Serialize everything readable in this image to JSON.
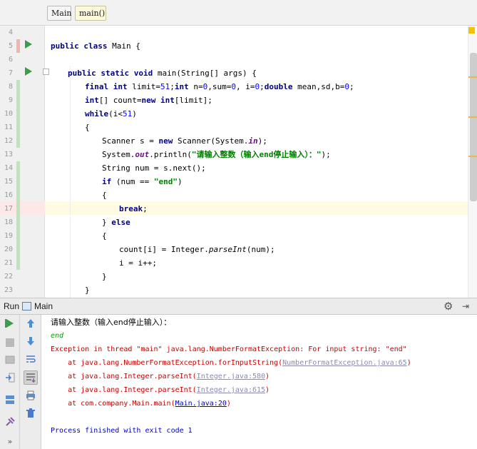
{
  "breadcrumb": [
    "Main",
    "main()"
  ],
  "editor": {
    "line_numbers": [
      "4",
      "5",
      "6",
      "7",
      "8",
      "9",
      "10",
      "11",
      "12",
      "13",
      "14",
      "15",
      "16",
      "17",
      "18",
      "19",
      "20",
      "21",
      "22",
      "23"
    ],
    "code": {
      "l5": {
        "a": "public class ",
        "b": "Main {"
      },
      "l7": {
        "a": "public static void ",
        "b": "main(String[] args) {"
      },
      "l8": {
        "a": "final int ",
        "b": "limit=",
        "c": "51",
        "d": ";",
        "e": "int ",
        "f": "n=",
        "g": "0",
        "h": ",sum=",
        "i": "0",
        "j": ", i=",
        "k": "0",
        "l": ";",
        "m": "double ",
        "n": "mean,sd,b=",
        "o": "0",
        "p": ";"
      },
      "l9": {
        "a": "int",
        "b": "[] count=",
        "c": "new int",
        "d": "[limit];"
      },
      "l10": {
        "a": "while",
        "b": "(i<",
        "c": "51",
        "d": ")"
      },
      "l11": "{",
      "l12": {
        "a": "Scanner s = ",
        "b": "new ",
        "c": "Scanner(System.",
        "d": "in",
        "e": ");"
      },
      "l13": {
        "a": "System.",
        "b": "out",
        "c": ".println(",
        "d": "\"请输入整数（输入end停止输入）：\"",
        "e": ");"
      },
      "l14": "String num = s.next();",
      "l15": {
        "a": "if ",
        "b": "(num == ",
        "c": "\"end\"",
        "d": ")"
      },
      "l16": "{",
      "l17": {
        "a": "break",
        "b": ";"
      },
      "l18": {
        "a": "} ",
        "b": "else"
      },
      "l19": "{",
      "l20": {
        "a": "count[i] = Integer.",
        "b": "parseInt",
        "c": "(num);"
      },
      "l21": {
        "a": "i = i++;"
      },
      "l22": "}",
      "l23": "}"
    }
  },
  "run_panel": {
    "label": "Run",
    "tab_name": "Main",
    "output": {
      "prompt": "请输入整数（输入end停止输入）：",
      "input_echo": "end",
      "exception": "Exception in thread \"main\" java.lang.NumberFormatException: For input string: \"end\"",
      "trace1": {
        "prefix": "    at java.lang.NumberFormatException.forInputString(",
        "link": "NumberFormatException.java:65",
        "suffix": ")"
      },
      "trace2": {
        "prefix": "    at java.lang.Integer.parseInt(",
        "link": "Integer.java:580",
        "suffix": ")"
      },
      "trace3": {
        "prefix": "    at java.lang.Integer.parseInt(",
        "link": "Integer.java:615",
        "suffix": ")"
      },
      "trace4": {
        "prefix": "    at com.company.Main.main(",
        "link": "Main.java:20",
        "suffix": ")"
      },
      "process": "Process finished with exit code 1"
    },
    "toolbar_icons": [
      "rerun-icon",
      "stop-icon",
      "restore-layout-icon",
      "exit-icon",
      "layout-icon",
      "pin-icon",
      "more-icon",
      "up-arrow-icon",
      "down-arrow-icon",
      "soft-wrap-icon",
      "scroll-to-end-icon",
      "print-icon",
      "trash-icon"
    ],
    "more_glyph": "»"
  },
  "colors": {
    "keyword": "#000080",
    "string": "#008000",
    "number": "#0000ff",
    "error": "#c80000",
    "link": "#0000cc",
    "run_green": "#3f9a4a"
  }
}
